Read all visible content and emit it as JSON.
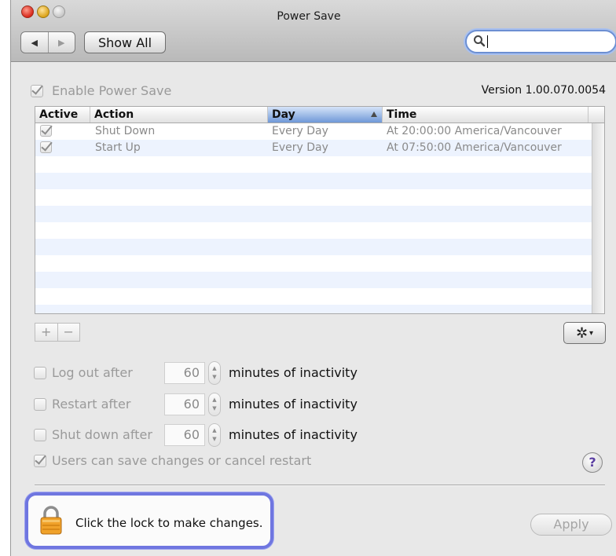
{
  "window": {
    "title": "Power Save"
  },
  "toolbar": {
    "back_symbol": "◀",
    "forward_symbol": "▶",
    "show_all_label": "Show All",
    "search_value": ""
  },
  "enable_label": "Enable Power Save",
  "enable_checked": true,
  "version_text": "Version 1.00.070.0054",
  "table": {
    "headers": {
      "active": "Active",
      "action": "Action",
      "day": "Day",
      "time": "Time"
    },
    "sorted_column": "Day",
    "rows": [
      {
        "active": true,
        "action": "Shut Down",
        "day": "Every Day",
        "time": "At 20:00:00 America/Vancouver"
      },
      {
        "active": true,
        "action": "Start Up",
        "day": "Every Day",
        "time": "At 07:50:00 America/Vancouver"
      }
    ]
  },
  "add_label": "+",
  "remove_label": "−",
  "gear_symbol": "✲",
  "gear_dropdown": "▾",
  "stepper_up": "▲",
  "stepper_down": "▼",
  "inactivity": [
    {
      "label": "Log out after",
      "value": "60",
      "suffix": "minutes of inactivity",
      "checked": false
    },
    {
      "label": "Restart after",
      "value": "60",
      "suffix": "minutes of inactivity",
      "checked": false
    },
    {
      "label": "Shut down after",
      "value": "60",
      "suffix": "minutes of inactivity",
      "checked": false
    }
  ],
  "users_can_save_label": "Users can save changes or cancel restart",
  "users_can_save_checked": true,
  "help_label": "?",
  "lock_text": "Click the lock to make changes.",
  "apply_label": "Apply",
  "colors": {
    "focus_ring": "#6c8fd2",
    "lock_highlight": "#6f76e0",
    "sorted_header": "#6f98d8",
    "lock_body": "#f0a22a"
  }
}
